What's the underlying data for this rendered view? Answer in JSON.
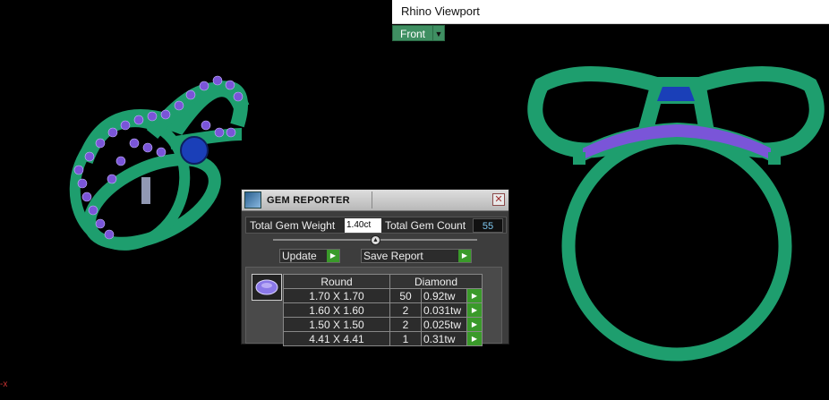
{
  "viewport": {
    "title": "Rhino Viewport",
    "view_name": "Front",
    "view_dropdown_arrow": "▼"
  },
  "gem_reporter": {
    "title": "GEM REPORTER",
    "close_glyph": "✕",
    "total_weight_label": "Total Gem Weight",
    "total_weight_value": "1.40ct",
    "total_count_label": "Total Gem Count",
    "total_count_value": "55",
    "update_label": "Update",
    "save_report_label": "Save Report",
    "arrow_glyph": "▶",
    "table": {
      "headers": {
        "shape": "Round",
        "material": "Diamond"
      },
      "rows": [
        {
          "size": "1.70 X 1.70",
          "count": "50",
          "weight": "0.92tw"
        },
        {
          "size": "1.60 X 1.60",
          "count": "2",
          "weight": "0.031tw"
        },
        {
          "size": "1.50 X 1.50",
          "count": "2",
          "weight": "0.025tw"
        },
        {
          "size": "4.41 X 4.41",
          "count": "1",
          "weight": "0.31tw"
        }
      ]
    }
  },
  "corner_text": "-x",
  "colors": {
    "background": "#000000",
    "metal": "#1e9e6e",
    "gem_purple": "#7a55d8",
    "center_stone": "#1a3fb8",
    "button_green": "#3a9a2a"
  }
}
